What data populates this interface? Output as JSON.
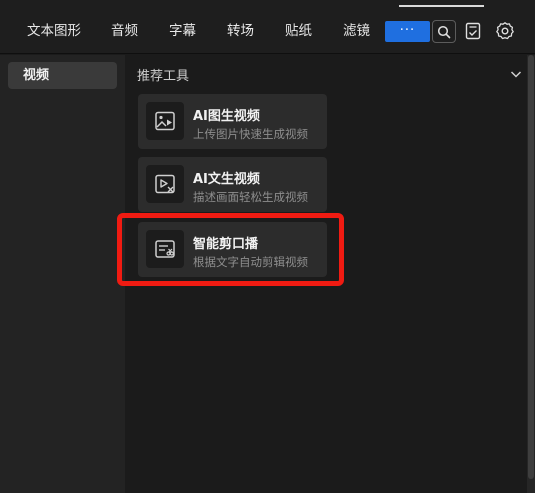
{
  "header": {
    "tabs": [
      {
        "label": "文本图形"
      },
      {
        "label": "音频"
      },
      {
        "label": "字幕"
      },
      {
        "label": "转场"
      },
      {
        "label": "贴纸"
      },
      {
        "label": "滤镜"
      }
    ],
    "more_label": "···",
    "icons": [
      "search-icon",
      "checklist-icon",
      "gear-icon"
    ],
    "accent_color": "#1f6fe0"
  },
  "sidebar": {
    "items": [
      {
        "label": "视频",
        "selected": true
      }
    ]
  },
  "main": {
    "section_title": "推荐工具",
    "cards": [
      {
        "title": "AI图生视频",
        "subtitle": "上传图片快速生成视频",
        "icon": "image-to-video-icon"
      },
      {
        "title": "AI文生视频",
        "subtitle": "描述画面轻松生成视频",
        "icon": "text-to-video-icon"
      },
      {
        "title": "智能剪口播",
        "subtitle": "根据文字自动剪辑视频",
        "icon": "smart-cut-icon",
        "highlighted": true
      }
    ]
  },
  "highlight_color": "#f01b12"
}
